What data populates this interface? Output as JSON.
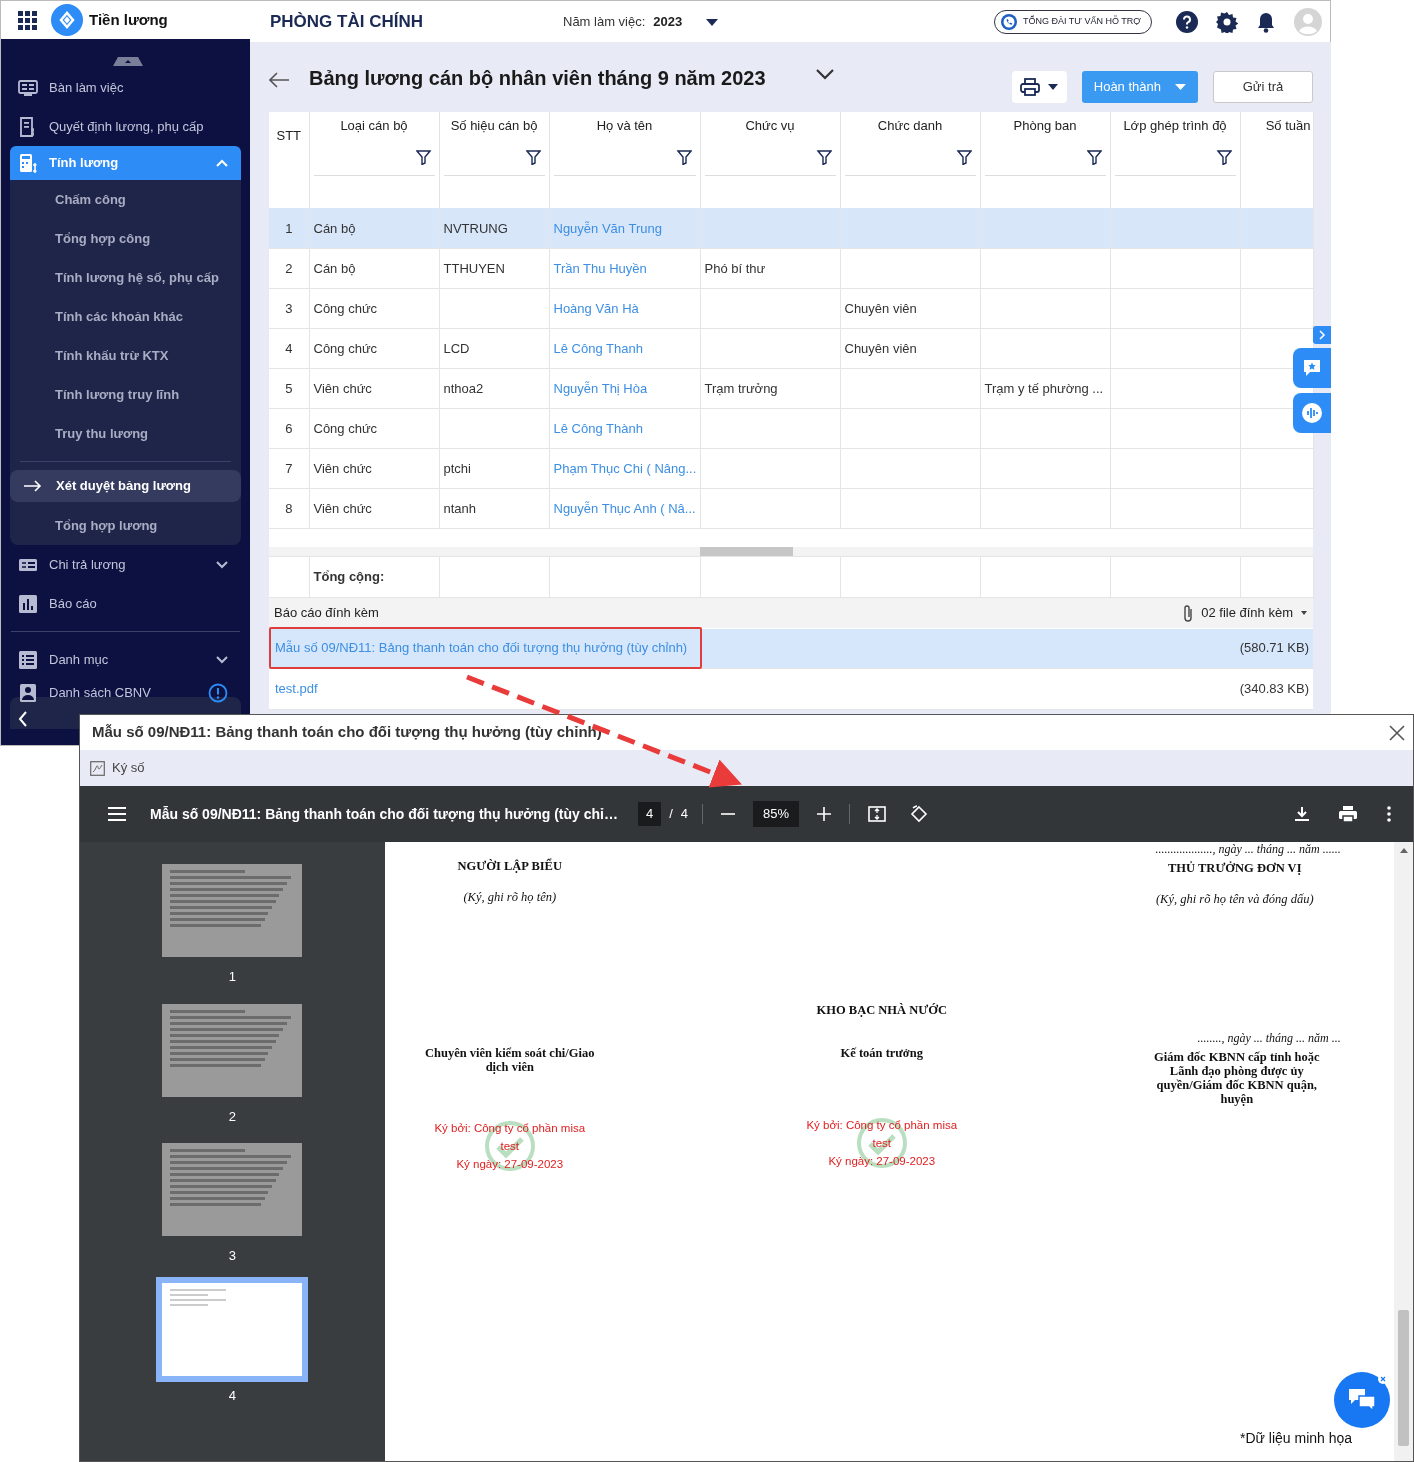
{
  "topbar": {
    "app_name": "Tiền lương",
    "org_name": "PHÒNG TÀI CHÍNH",
    "year_label": "Năm làm việc:",
    "year": "2023",
    "support_label": "TỔNG ĐÀI TƯ VẤN HỖ TRỢ"
  },
  "sidebar": {
    "items": [
      {
        "kind": "item",
        "label": "Bàn làm việc",
        "selected": false
      },
      {
        "kind": "item",
        "label": "Quyết định lương, phụ cấp",
        "selected": false
      },
      {
        "kind": "group",
        "label": "Tính lương",
        "selected": true,
        "expanded": true,
        "children": [
          {
            "kind": "item",
            "label": "Chấm công",
            "selected": false
          },
          {
            "kind": "item",
            "label": "Tổng hợp công",
            "selected": false
          },
          {
            "kind": "item",
            "label": "Tính lương hệ số, phụ cấp",
            "selected": false
          },
          {
            "kind": "item",
            "label": "Tính các khoản khác",
            "selected": false
          },
          {
            "kind": "item",
            "label": "Tính khấu trừ KTX",
            "selected": false
          },
          {
            "kind": "item",
            "label": "Tính lương truy lĩnh",
            "selected": false
          },
          {
            "kind": "item",
            "label": "Truy thu lương",
            "selected": false
          },
          {
            "kind": "divider"
          },
          {
            "kind": "item",
            "label": "Xét duyệt bảng lương",
            "selected": true
          },
          {
            "kind": "item",
            "label": "Tổng hợp lương",
            "selected": false
          }
        ]
      },
      {
        "kind": "group",
        "label": "Chi trả lương",
        "selected": false,
        "expanded": false
      },
      {
        "kind": "item",
        "label": "Báo cáo",
        "selected": false
      },
      {
        "kind": "divider"
      },
      {
        "kind": "group",
        "label": "Danh mục",
        "selected": false,
        "expanded": false
      },
      {
        "kind": "item",
        "label": "Danh sách CBNV",
        "selected": false,
        "alert": true
      }
    ]
  },
  "page": {
    "title": "Bảng lương cán bộ nhân viên tháng 9 năm 2023",
    "complete_button": "Hoàn thành",
    "return_button": "Gửi trả"
  },
  "table": {
    "columns": [
      {
        "label": "STT",
        "filter": false
      },
      {
        "label": "Loại cán bộ",
        "filter": true
      },
      {
        "label": "Số hiệu cán bộ",
        "filter": true
      },
      {
        "label": "Họ và tên",
        "filter": true
      },
      {
        "label": "Chức vụ",
        "filter": true
      },
      {
        "label": "Chức danh",
        "filter": true
      },
      {
        "label": "Phòng ban",
        "filter": true
      },
      {
        "label": "Lớp ghép trình độ",
        "filter": true
      },
      {
        "label": "Số tuần",
        "filter": false
      }
    ],
    "rows": [
      {
        "stt": "1",
        "type": "Cán bộ",
        "code": "NVTRUNG",
        "name": "Nguyễn Văn Trung",
        "selected": true
      },
      {
        "stt": "2",
        "type": "Cán bộ",
        "code": "TTHUYEN",
        "name": "Trần Thu Huyền",
        "position": "Phó bí thư",
        "selected": false
      },
      {
        "stt": "3",
        "type": "Công chức",
        "name": "Hoàng Văn Hà",
        "title": "Chuyên viên",
        "selected": false
      },
      {
        "stt": "4",
        "type": "Công chức",
        "code": "LCD",
        "name": "Lê Công Thanh",
        "title": "Chuyên viên",
        "selected": false
      },
      {
        "stt": "5",
        "type": "Viên chức",
        "code": "nthoa2",
        "name": "Nguyễn Thị Hòa",
        "position": "Trạm trưởng",
        "department": "Trạm y tế phường ...",
        "selected": false
      },
      {
        "stt": "6",
        "type": "Công chức",
        "name": "Lê Công Thành",
        "selected": false
      },
      {
        "stt": "7",
        "type": "Viên chức",
        "code": "ptchi",
        "name": "Phạm Thục Chi ( Nâng...",
        "selected": false
      },
      {
        "stt": "8",
        "type": "Viên chức",
        "code": "ntanh",
        "name": "Nguyễn Thục Anh ( Nâ...",
        "selected": false
      }
    ],
    "total_label": "Tổng cộng:"
  },
  "attachments": {
    "title": "Báo cáo đính kèm",
    "count": "02 file đính kèm",
    "files": [
      {
        "name": "Mẫu số 09/NĐ11: Bảng thanh toán cho đối tượng thụ hưởng (tùy chỉnh)",
        "size": "(580.71 KB)",
        "selected": true,
        "highlighted": true
      },
      {
        "name": "test.pdf",
        "size": "(340.83 KB)",
        "selected": false,
        "highlighted": false
      }
    ]
  },
  "dialog": {
    "title": "Mẫu số 09/NĐ11: Bảng thanh toán cho đối tượng thụ hưởng (tùy chỉnh)",
    "sign_label": "Ký số",
    "viewer": {
      "title": "Mẫu số 09/NĐ11: Bảng thanh toán cho đối tượng thụ hưởng (tùy chỉ…",
      "page": "4",
      "page_separator": "/",
      "page_count": "4",
      "zoom": "85%",
      "thumbnails": [
        {
          "label": "1",
          "selected": false
        },
        {
          "label": "2",
          "selected": false
        },
        {
          "label": "3",
          "selected": false
        },
        {
          "label": "4",
          "selected": true
        }
      ],
      "document": {
        "preparer": {
          "heading": "NGƯỜI LẬP BIỂU",
          "note": "(Ký, ghi rõ họ tên)"
        },
        "head": {
          "date_line": "..................., ngày ... tháng ... năm ......",
          "heading": "THỦ TRƯỞNG ĐƠN VỊ",
          "note": "(Ký, ghi rõ họ tên và đóng dấu)"
        },
        "treasury_heading": "KHO BẠC NHÀ NƯỚC",
        "signers": [
          {
            "heading": "Chuyên viên kiểm soát chi/Giao dịch viên",
            "signature": [
              "Ký bởi: Công ty cổ phần misa",
              "test",
              "Ký ngày: 27-09-2023"
            ]
          },
          {
            "heading": "Kế toán trưởng",
            "signature": [
              "Ký bởi: Công ty cổ phần misa",
              "test",
              "Ký ngày: 27-09-2023"
            ]
          },
          {
            "date_line": "........, ngày ... tháng ... năm ...",
            "heading": "Giám đốc KBNN cấp tỉnh hoặc Lãnh đạo phòng được ủy quyền/Giám đốc KBNN quận, huyện"
          }
        ]
      }
    }
  },
  "note": "*Dữ liệu minh họa"
}
